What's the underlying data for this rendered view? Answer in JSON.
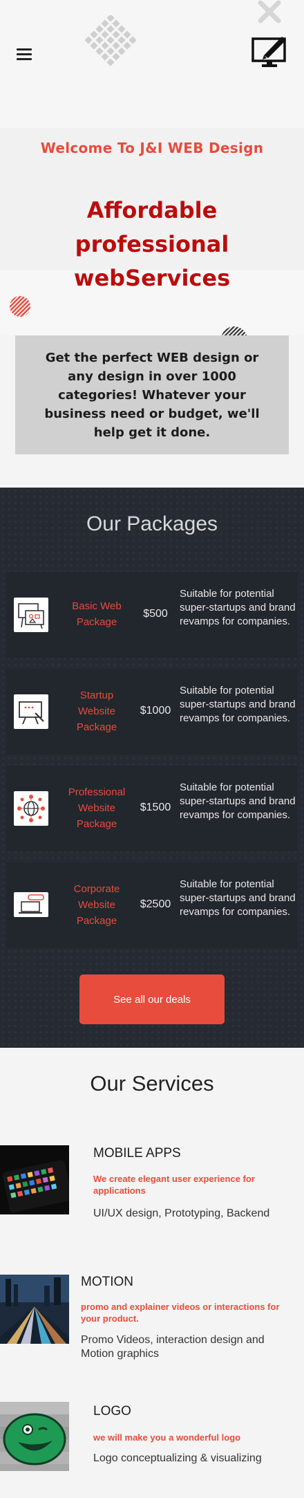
{
  "header": {
    "menu_icon": "hamburger-menu-icon",
    "logo_icon": "monitor-pen-icon"
  },
  "hero": {
    "welcome": "Welcome To J&I WEB Design",
    "title": "Affordable professional webServices",
    "promo": "Get the perfect WEB design or any design in over 1000 categories! Whatever your business need or budget, we'll help get it done."
  },
  "packages": {
    "title": "Our Packages",
    "items": [
      {
        "name": "Basic Web Package",
        "price": "$500",
        "desc": "Suitable for potential super-startups and brand revamps for companies.",
        "icon": "presentation-board-icon"
      },
      {
        "name": "Startup Website Package",
        "price": "$1000",
        "desc": "Suitable for potential super-startups and brand revamps for companies.",
        "icon": "easel-chart-icon"
      },
      {
        "name": "Professional Website Package",
        "price": "$1500",
        "desc": "Suitable for potential super-startups and brand revamps for companies.",
        "icon": "globe-network-icon"
      },
      {
        "name": "Corporate Website Package",
        "price": "$2500",
        "desc": "Suitable for potential super-startups and brand revamps for companies.",
        "icon": "laptop-icon"
      }
    ],
    "cta": "See all our deals"
  },
  "services": {
    "title": "Our Services",
    "items": [
      {
        "heading": "MOBILE APPS",
        "sub": "We create elegant user experience for applications",
        "text": "UI/UX design, Prototyping, Backend"
      },
      {
        "heading": "MOTION",
        "sub": "promo and explainer videos or interactions for your product.",
        "text": "Promo Videos, interaction design and Motion graphics"
      },
      {
        "heading": "LOGO",
        "sub": "we will make you a wonderful logo",
        "text": "Logo conceptualizing & visualizing"
      }
    ]
  },
  "colors": {
    "accent": "#e74c3c",
    "title_red": "#bb0d0d",
    "dark_bg": "#252a33"
  }
}
